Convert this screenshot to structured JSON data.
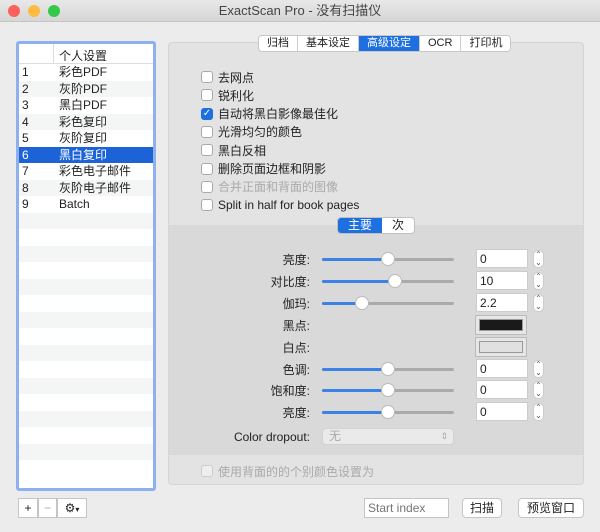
{
  "window": {
    "title": "ExactScan Pro - 没有扫描仪"
  },
  "profiles": {
    "header": "个人设置",
    "items": [
      {
        "n": "1",
        "label": "彩色PDF"
      },
      {
        "n": "2",
        "label": "灰阶PDF"
      },
      {
        "n": "3",
        "label": "黑白PDF"
      },
      {
        "n": "4",
        "label": "彩色复印"
      },
      {
        "n": "5",
        "label": "灰阶复印"
      },
      {
        "n": "6",
        "label": "黑白复印",
        "selected": true
      },
      {
        "n": "7",
        "label": "彩色电子邮件"
      },
      {
        "n": "8",
        "label": "灰阶电子邮件"
      },
      {
        "n": "9",
        "label": "Batch"
      }
    ]
  },
  "tabs": [
    "归档",
    "基本设定",
    "高级设定",
    "OCR",
    "打印机"
  ],
  "active_tab": "高级设定",
  "options": [
    {
      "label": "去网点",
      "checked": false
    },
    {
      "label": "锐利化",
      "checked": false
    },
    {
      "label": "自动将黑白影像最佳化",
      "checked": true
    },
    {
      "label": "光滑均匀的颜色",
      "checked": false
    },
    {
      "label": "黑白反相",
      "checked": false
    },
    {
      "label": "删除页面边框和阴影",
      "checked": false
    },
    {
      "label": "合并正面和背面的图像",
      "checked": false,
      "disabled": true
    },
    {
      "label": "Split in half for book pages",
      "checked": false
    }
  ],
  "segments": [
    "主要",
    "次"
  ],
  "adjust": {
    "brightness": {
      "label": "亮度:",
      "value": "0",
      "level": 0.5
    },
    "contrast": {
      "label": "对比度:",
      "value": "10",
      "level": 0.55
    },
    "gamma": {
      "label": "伽玛:",
      "value": "2.2",
      "level": 0.3
    },
    "black_point": {
      "label": "黑点:",
      "color": "#1a1a1a"
    },
    "white_point": {
      "label": "白点:",
      "color": "#e0e0e0"
    },
    "hue": {
      "label": "色调:",
      "value": "0",
      "level": 0.5
    },
    "saturation": {
      "label": "饱和度:",
      "value": "0",
      "level": 0.5
    },
    "lightness": {
      "label": "亮度:",
      "value": "0",
      "level": 0.5
    },
    "color_dropout": {
      "label": "Color dropout:",
      "value": "无"
    }
  },
  "back_option": {
    "label": "使用背面的的个别颜色设置为",
    "checked": false,
    "disabled": true
  },
  "footer": {
    "add": "+",
    "remove": "−",
    "gear": "⚙",
    "start_index_placeholder": "Start index",
    "scan": "扫描",
    "preview": "预览窗口"
  },
  "colors": {
    "accent": "#1e6fe0",
    "selection": "#1b63d6"
  }
}
